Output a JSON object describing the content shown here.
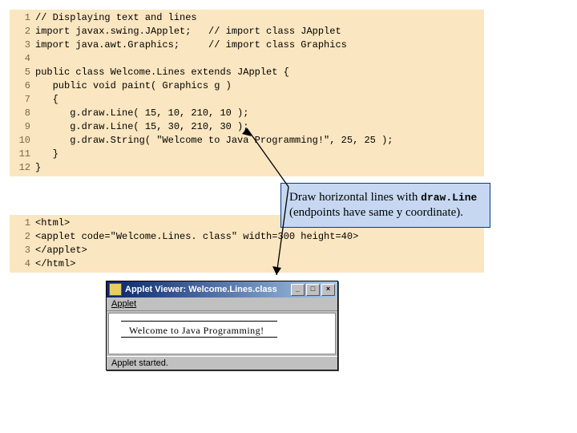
{
  "code1": {
    "lines": [
      {
        "n": "1",
        "t": "// Displaying text and lines"
      },
      {
        "n": "2",
        "t": "import javax.swing.JApplet;   // import class JApplet"
      },
      {
        "n": "3",
        "t": "import java.awt.Graphics;     // import class Graphics"
      },
      {
        "n": "4",
        "t": ""
      },
      {
        "n": "5",
        "t": "public class Welcome.Lines extends JApplet {"
      },
      {
        "n": "6",
        "t": "   public void paint( Graphics g )"
      },
      {
        "n": "7",
        "t": "   {"
      },
      {
        "n": "8",
        "t": "      g.draw.Line( 15, 10, 210, 10 );"
      },
      {
        "n": "9",
        "t": "      g.draw.Line( 15, 30, 210, 30 );"
      },
      {
        "n": "10",
        "t": "      g.draw.String( \"Welcome to Java Programming!\", 25, 25 );"
      },
      {
        "n": "11",
        "t": "   }"
      },
      {
        "n": "12",
        "t": "}"
      }
    ]
  },
  "callout": {
    "pre": "Draw horizontal lines with ",
    "kw": "draw.Line",
    "post": " (endpoints have same y coordinate)."
  },
  "code2": {
    "lines": [
      {
        "n": "1",
        "t": "<html>"
      },
      {
        "n": "2",
        "t": "<applet code=\"Welcome.Lines. class\" width=300 height=40>"
      },
      {
        "n": "3",
        "t": "</applet>"
      },
      {
        "n": "4",
        "t": "</html>"
      }
    ]
  },
  "viewer": {
    "title": "Applet Viewer: Welcome.Lines.class",
    "menu_letter": "A",
    "menu_rest": "pplet",
    "min": "_",
    "max": "□",
    "close": "×",
    "welcome": "Welcome to Java Programming!",
    "status": "Applet started."
  },
  "chart_data": {
    "type": "table",
    "title": "Java code listings and applet output",
    "series": []
  }
}
